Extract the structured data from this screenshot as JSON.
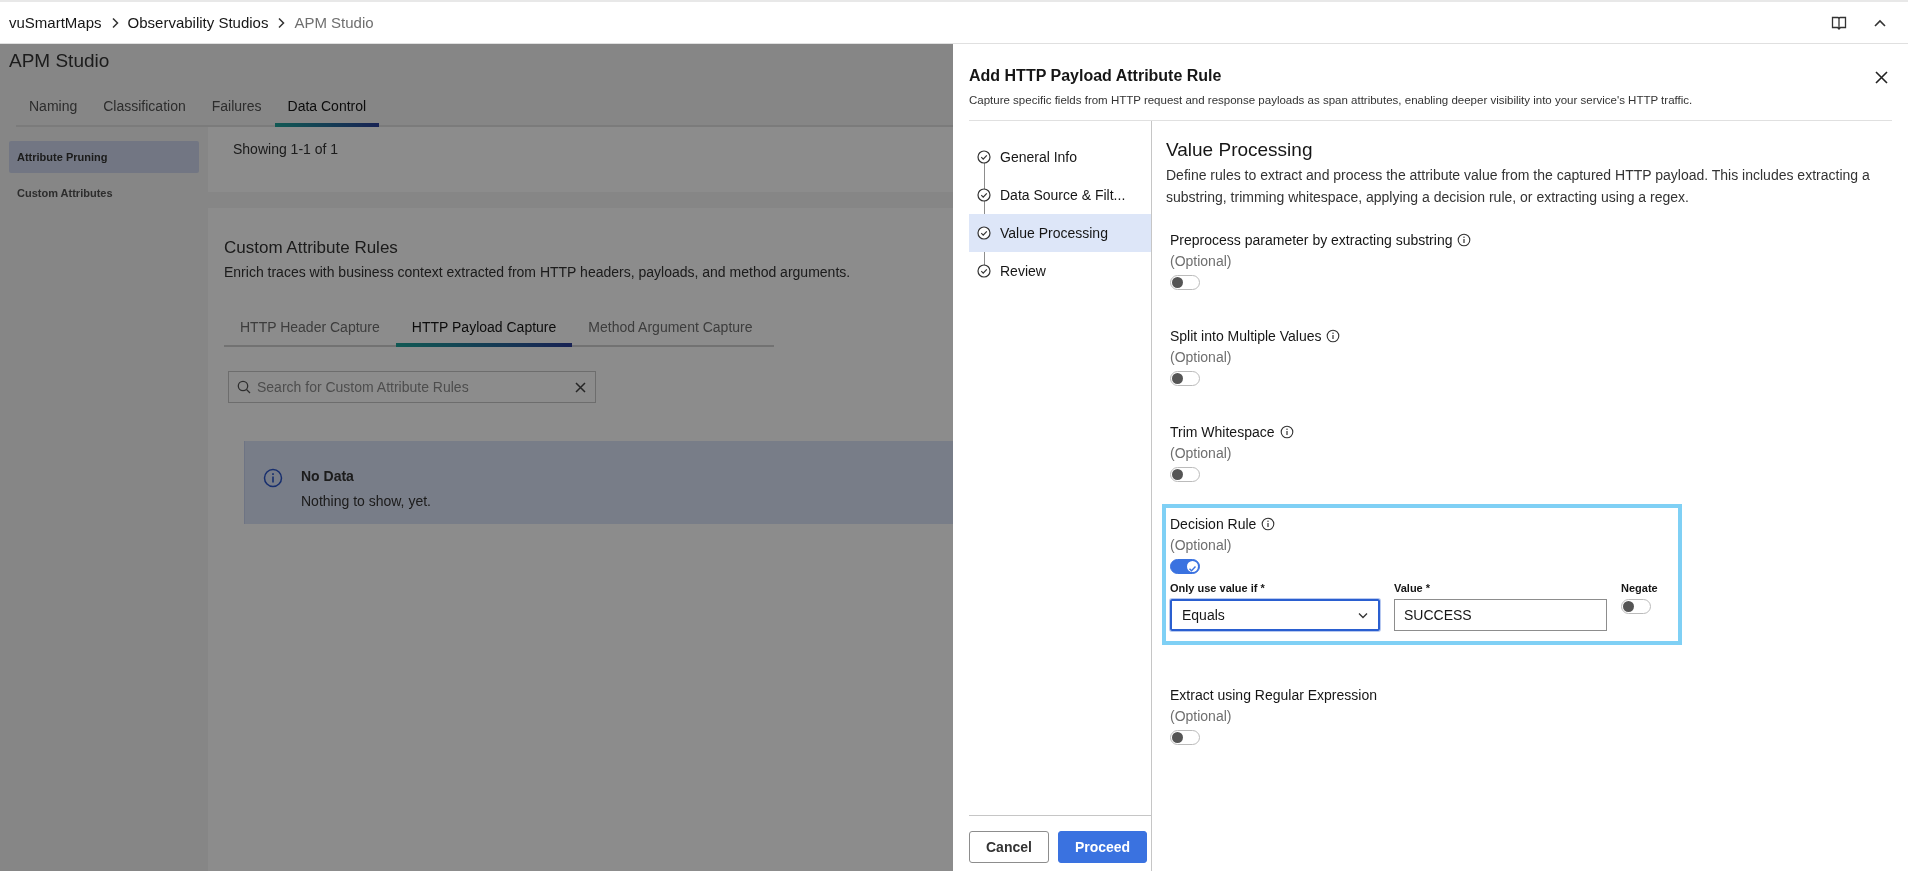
{
  "breadcrumbs": [
    {
      "label": "vuSmartMaps",
      "current": false
    },
    {
      "label": "Observability Studios",
      "current": false
    },
    {
      "label": "APM Studio",
      "current": true
    }
  ],
  "background_page": {
    "title": "APM Studio",
    "tabs": [
      {
        "label": "Naming",
        "selected": false
      },
      {
        "label": "Classification",
        "selected": false
      },
      {
        "label": "Failures",
        "selected": false
      },
      {
        "label": "Data Control",
        "selected": true
      }
    ],
    "nav": [
      {
        "label": "Attribute Pruning",
        "selected": true
      },
      {
        "label": "Custom Attributes",
        "selected": false
      }
    ],
    "showing": "Showing 1-1 of 1",
    "card": {
      "title": "Custom Attribute Rules",
      "description": "Enrich traces with business context extracted from HTTP headers, payloads, and method arguments.",
      "tabs": [
        {
          "label": "HTTP Header Capture",
          "selected": false
        },
        {
          "label": "HTTP Payload Capture",
          "selected": true
        },
        {
          "label": "Method Argument Capture",
          "selected": false
        }
      ],
      "search": {
        "placeholder": "Search for Custom Attribute Rules"
      },
      "notice": {
        "title": "No Data",
        "message": "Nothing to show, yet."
      }
    }
  },
  "drawer": {
    "title": "Add HTTP Payload Attribute Rule",
    "subtitle": "Capture specific fields from HTTP request and response payloads as span attributes, enabling deeper visibility into your service's HTTP traffic.",
    "steps": [
      {
        "label": "General Info",
        "selected": false
      },
      {
        "label": "Data Source & Filt...",
        "selected": false
      },
      {
        "label": "Value Processing",
        "selected": true
      },
      {
        "label": "Review",
        "selected": false
      }
    ],
    "section": {
      "title": "Value Processing",
      "description": "Define rules to extract and process the attribute value from the captured HTTP payload. This includes extracting a substring, trimming whitespace, applying a decision rule, or extracting using a regex."
    },
    "options": [
      {
        "kind": "toggle",
        "label": "Preprocess parameter by extracting substring",
        "info": true,
        "hint": "(Optional)",
        "on": false,
        "highlighted": false
      },
      {
        "kind": "toggle",
        "label": "Split into Multiple Values",
        "info": true,
        "hint": "(Optional)",
        "on": false,
        "highlighted": false
      },
      {
        "kind": "toggle",
        "label": "Trim Whitespace",
        "info": true,
        "hint": "(Optional)",
        "on": false,
        "highlighted": false
      },
      {
        "kind": "decision",
        "label": "Decision Rule",
        "info": true,
        "hint": "(Optional)",
        "on": true,
        "highlighted": true,
        "condition": {
          "label": "Only use value if *",
          "value": "Equals",
          "focused": true
        },
        "value": {
          "label": "Value *",
          "value": "SUCCESS"
        },
        "negate": {
          "label": "Negate",
          "on": false
        }
      },
      {
        "kind": "toggle",
        "label": "Extract using Regular Expression",
        "info": false,
        "hint": "(Optional)",
        "on": false,
        "highlighted": false
      }
    ],
    "buttons": [
      {
        "label": "Cancel",
        "kind": "secondary"
      },
      {
        "label": "Proceed",
        "kind": "primary"
      }
    ]
  }
}
